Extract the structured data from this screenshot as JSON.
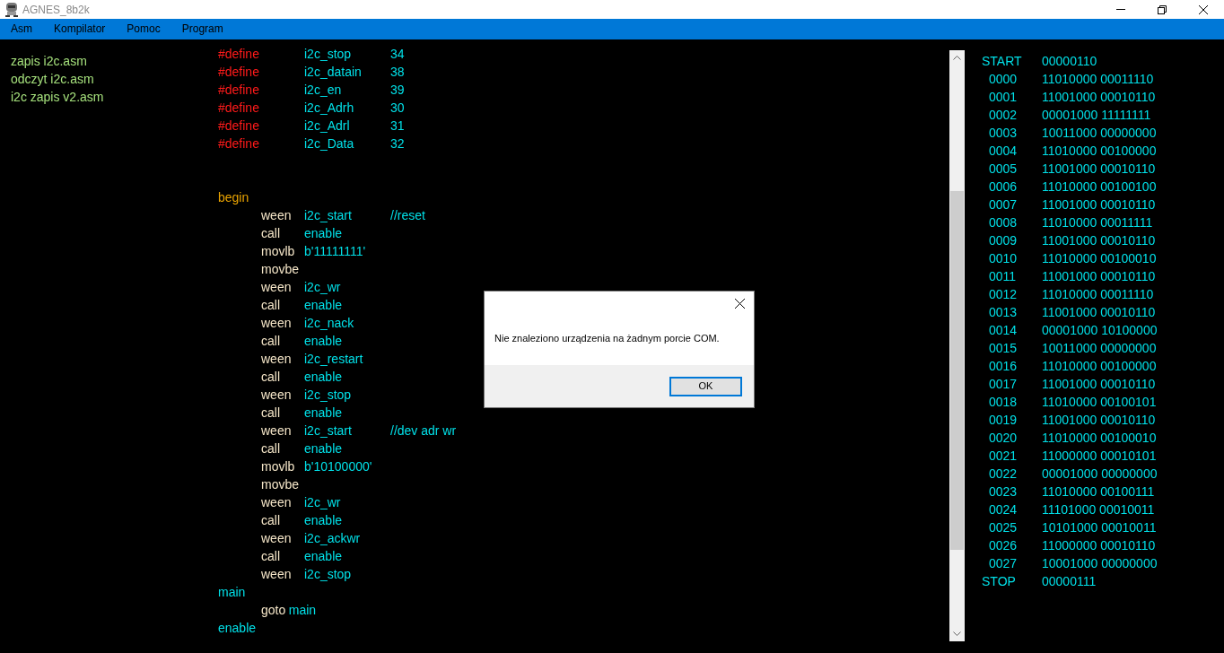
{
  "window": {
    "title": "AGNES_8b2k"
  },
  "menu": [
    "Asm",
    "Kompilator",
    "Pomoc",
    "Program"
  ],
  "files": [
    "zapis i2c.asm",
    "odczyt i2c.asm",
    "i2c zapis v2.asm"
  ],
  "code": [
    {
      "kind": "define",
      "directive": "#define",
      "name": "i2c_stop",
      "value": "34"
    },
    {
      "kind": "define",
      "directive": "#define",
      "name": "i2c_datain",
      "value": "38"
    },
    {
      "kind": "define",
      "directive": "#define",
      "name": "i2c_en",
      "value": "39"
    },
    {
      "kind": "define",
      "directive": "#define",
      "name": "i2c_Adrh",
      "value": "30"
    },
    {
      "kind": "define",
      "directive": "#define",
      "name": "i2c_Adrl",
      "value": "31"
    },
    {
      "kind": "define",
      "directive": "#define",
      "name": "i2c_Data",
      "value": "32"
    },
    {
      "kind": "blank"
    },
    {
      "kind": "blank"
    },
    {
      "kind": "label",
      "text": "begin",
      "color": "#e8a200"
    },
    {
      "kind": "instruction",
      "op": "ween",
      "arg": "i2c_start",
      "comment": "//reset"
    },
    {
      "kind": "instruction",
      "op": "call",
      "arg": "enable"
    },
    {
      "kind": "instruction",
      "op": "movlb",
      "arg": "b'11111111'"
    },
    {
      "kind": "instruction",
      "op": "movbe"
    },
    {
      "kind": "instruction",
      "op": "ween",
      "arg": "i2c_wr"
    },
    {
      "kind": "instruction",
      "op": "call",
      "arg": "enable"
    },
    {
      "kind": "instruction",
      "op": "ween",
      "arg": "i2c_nack"
    },
    {
      "kind": "instruction",
      "op": "call",
      "arg": "enable"
    },
    {
      "kind": "instruction",
      "op": "ween",
      "arg": "i2c_restart"
    },
    {
      "kind": "instruction",
      "op": "call",
      "arg": "enable"
    },
    {
      "kind": "instruction",
      "op": "ween",
      "arg": "i2c_stop"
    },
    {
      "kind": "instruction",
      "op": "call",
      "arg": "enable"
    },
    {
      "kind": "instruction",
      "op": "ween",
      "arg": "i2c_start",
      "comment": "//dev adr wr"
    },
    {
      "kind": "instruction",
      "op": "call",
      "arg": "enable"
    },
    {
      "kind": "instruction",
      "op": "movlb",
      "arg": "b'10100000'"
    },
    {
      "kind": "instruction",
      "op": "movbe"
    },
    {
      "kind": "instruction",
      "op": "ween",
      "arg": "i2c_wr"
    },
    {
      "kind": "instruction",
      "op": "call",
      "arg": "enable"
    },
    {
      "kind": "instruction",
      "op": "ween",
      "arg": "i2c_ackwr"
    },
    {
      "kind": "instruction",
      "op": "call",
      "arg": "enable"
    },
    {
      "kind": "instruction",
      "op": "ween",
      "arg": "i2c_stop"
    },
    {
      "kind": "label",
      "text": "main",
      "color": "#00e0e8"
    },
    {
      "kind": "jump",
      "op": "goto",
      "arg": "main"
    },
    {
      "kind": "label",
      "text": "enable",
      "color": "#00e0e8"
    }
  ],
  "output": [
    {
      "kind": "marker",
      "address": "START",
      "value": "00000110"
    },
    {
      "kind": "word",
      "address": "0000",
      "value": "11010000 00011110"
    },
    {
      "kind": "word",
      "address": "0001",
      "value": "11001000 00010110"
    },
    {
      "kind": "word",
      "address": "0002",
      "value": "00001000 11111111"
    },
    {
      "kind": "word",
      "address": "0003",
      "value": "10011000 00000000"
    },
    {
      "kind": "word",
      "address": "0004",
      "value": "11010000 00100000"
    },
    {
      "kind": "word",
      "address": "0005",
      "value": "11001000 00010110"
    },
    {
      "kind": "word",
      "address": "0006",
      "value": "11010000 00100100"
    },
    {
      "kind": "word",
      "address": "0007",
      "value": "11001000 00010110"
    },
    {
      "kind": "word",
      "address": "0008",
      "value": "11010000 00011111"
    },
    {
      "kind": "word",
      "address": "0009",
      "value": "11001000 00010110"
    },
    {
      "kind": "word",
      "address": "0010",
      "value": "11010000 00100010"
    },
    {
      "kind": "word",
      "address": "0011",
      "value": "11001000 00010110"
    },
    {
      "kind": "word",
      "address": "0012",
      "value": "11010000 00011110"
    },
    {
      "kind": "word",
      "address": "0013",
      "value": "11001000 00010110"
    },
    {
      "kind": "word",
      "address": "0014",
      "value": "00001000 10100000"
    },
    {
      "kind": "word",
      "address": "0015",
      "value": "10011000 00000000"
    },
    {
      "kind": "word",
      "address": "0016",
      "value": "11010000 00100000"
    },
    {
      "kind": "word",
      "address": "0017",
      "value": "11001000 00010110"
    },
    {
      "kind": "word",
      "address": "0018",
      "value": "11010000 00100101"
    },
    {
      "kind": "word",
      "address": "0019",
      "value": "11001000 00010110"
    },
    {
      "kind": "word",
      "address": "0020",
      "value": "11010000 00100010"
    },
    {
      "kind": "word",
      "address": "0021",
      "value": "11000000 00010101"
    },
    {
      "kind": "word",
      "address": "0022",
      "value": "00001000 00000000"
    },
    {
      "kind": "word",
      "address": "0023",
      "value": "11010000 00100111"
    },
    {
      "kind": "word",
      "address": "0024",
      "value": "11101000 00010011"
    },
    {
      "kind": "word",
      "address": "0025",
      "value": "10101000 00010011"
    },
    {
      "kind": "word",
      "address": "0026",
      "value": "11000000 00010110"
    },
    {
      "kind": "word",
      "address": "0027",
      "value": "10001000 00000000"
    },
    {
      "kind": "marker",
      "address": "STOP",
      "value": "00000111"
    }
  ],
  "dialog": {
    "message": "Nie znaleziono urządzenia na żadnym porcie COM.",
    "button": "OK"
  }
}
